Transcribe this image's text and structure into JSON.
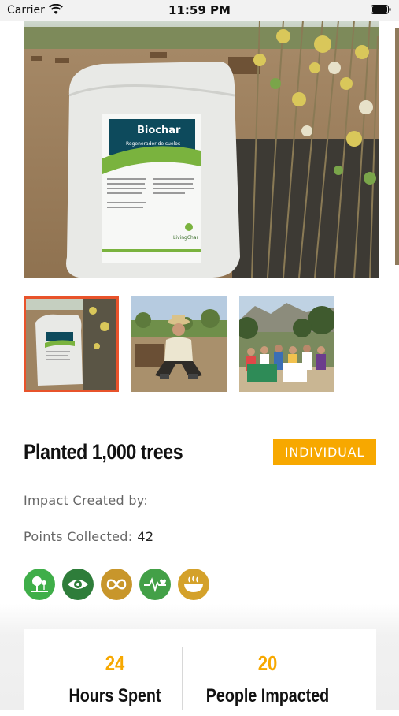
{
  "status_bar": {
    "carrier": "Carrier",
    "time": "11:59 PM",
    "icons": [
      "wifi-icon",
      "battery-icon"
    ]
  },
  "hero": {
    "bag_brand": "Biochar",
    "bag_subtitle": "Regenerador de suelos",
    "bag_logo": "LivingChar"
  },
  "thumbnails": [
    {
      "name": "thumb-biochar-bag",
      "selected": true
    },
    {
      "name": "thumb-volunteer-planting",
      "selected": false
    },
    {
      "name": "thumb-group-photo",
      "selected": false
    }
  ],
  "activity": {
    "title": "Planted 1,000 trees",
    "badge": "INDIVIDUAL",
    "impact_created_by_label": "Impact Created by:",
    "points_label": "Points Collected:",
    "points_value": "42"
  },
  "sdg_icons": [
    {
      "name": "life-on-land-icon",
      "color": "#3fae49"
    },
    {
      "name": "eye-icon",
      "color": "#2e7d3a"
    },
    {
      "name": "infinity-icon",
      "color": "#c8962b"
    },
    {
      "name": "health-pulse-icon",
      "color": "#43a047"
    },
    {
      "name": "food-bowl-icon",
      "color": "#d4a12a"
    }
  ],
  "stats": {
    "hours_value": "24",
    "hours_label": "Hours Spent",
    "people_value": "20",
    "people_label": "People Impacted"
  },
  "colors": {
    "accent": "#f7a800",
    "selected_border": "#e8532b"
  }
}
